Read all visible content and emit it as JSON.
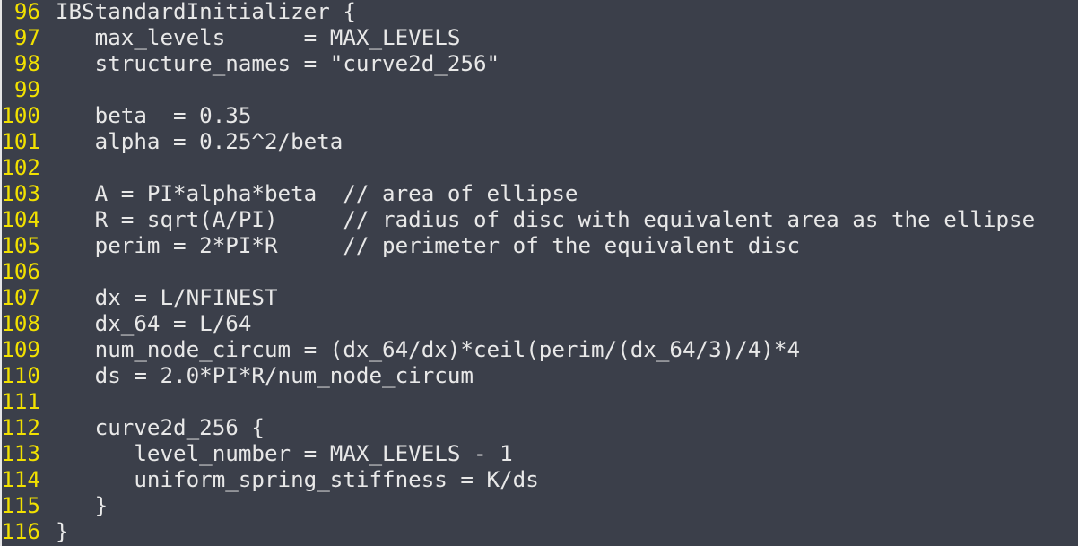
{
  "colors": {
    "background": "#3b3f4a",
    "line_number": "#f2e100",
    "text": "#e8e8e8",
    "left_edge": "#e6e6e6"
  },
  "lines": [
    {
      "num": "96",
      "text": "IBStandardInitializer {"
    },
    {
      "num": "97",
      "text": "   max_levels      = MAX_LEVELS"
    },
    {
      "num": "98",
      "text": "   structure_names = \"curve2d_256\""
    },
    {
      "num": "99",
      "text": ""
    },
    {
      "num": "100",
      "text": "   beta  = 0.35"
    },
    {
      "num": "101",
      "text": "   alpha = 0.25^2/beta"
    },
    {
      "num": "102",
      "text": ""
    },
    {
      "num": "103",
      "text": "   A = PI*alpha*beta  // area of ellipse"
    },
    {
      "num": "104",
      "text": "   R = sqrt(A/PI)     // radius of disc with equivalent area as the ellipse"
    },
    {
      "num": "105",
      "text": "   perim = 2*PI*R     // perimeter of the equivalent disc"
    },
    {
      "num": "106",
      "text": ""
    },
    {
      "num": "107",
      "text": "   dx = L/NFINEST"
    },
    {
      "num": "108",
      "text": "   dx_64 = L/64"
    },
    {
      "num": "109",
      "text": "   num_node_circum = (dx_64/dx)*ceil(perim/(dx_64/3)/4)*4"
    },
    {
      "num": "110",
      "text": "   ds = 2.0*PI*R/num_node_circum"
    },
    {
      "num": "111",
      "text": ""
    },
    {
      "num": "112",
      "text": "   curve2d_256 {"
    },
    {
      "num": "113",
      "text": "      level_number = MAX_LEVELS - 1"
    },
    {
      "num": "114",
      "text": "      uniform_spring_stiffness = K/ds"
    },
    {
      "num": "115",
      "text": "   }"
    },
    {
      "num": "116",
      "text": "}"
    }
  ]
}
